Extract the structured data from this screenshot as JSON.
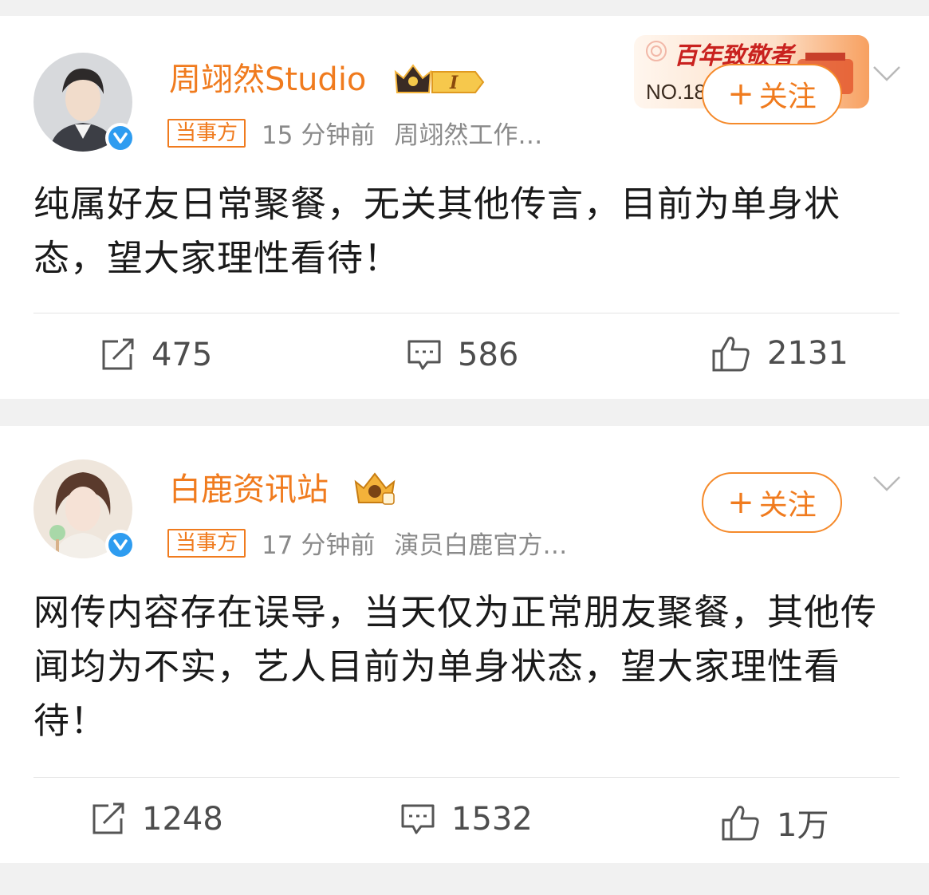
{
  "posts": [
    {
      "username": "周翊然Studio",
      "badge_level": "I",
      "tag": "当事方",
      "time": "15 分钟前",
      "source": "周翊然工作…",
      "follow_label": "关注",
      "content": "纯属好友日常聚餐，无关其他传言，目前为单身状态，望大家理性看待！",
      "banner": {
        "title": "百年致敬者",
        "rank": "NO.18"
      },
      "actions": {
        "repost": "475",
        "comment": "586",
        "like": "2131"
      }
    },
    {
      "username": "白鹿资讯站",
      "tag": "当事方",
      "time": "17 分钟前",
      "source": "演员白鹿官方…",
      "follow_label": "关注",
      "content": "网传内容存在误导，当天仅为正常朋友聚餐，其他传闻均为不实，艺人目前为单身状态，望大家理性看待！",
      "actions": {
        "repost": "1248",
        "comment": "1532",
        "like": "1万"
      }
    }
  ],
  "colors": {
    "accent": "#f07b1e",
    "verified": "#2e9cf0",
    "text": "#1a1a1a",
    "meta": "#8a8a8a"
  }
}
